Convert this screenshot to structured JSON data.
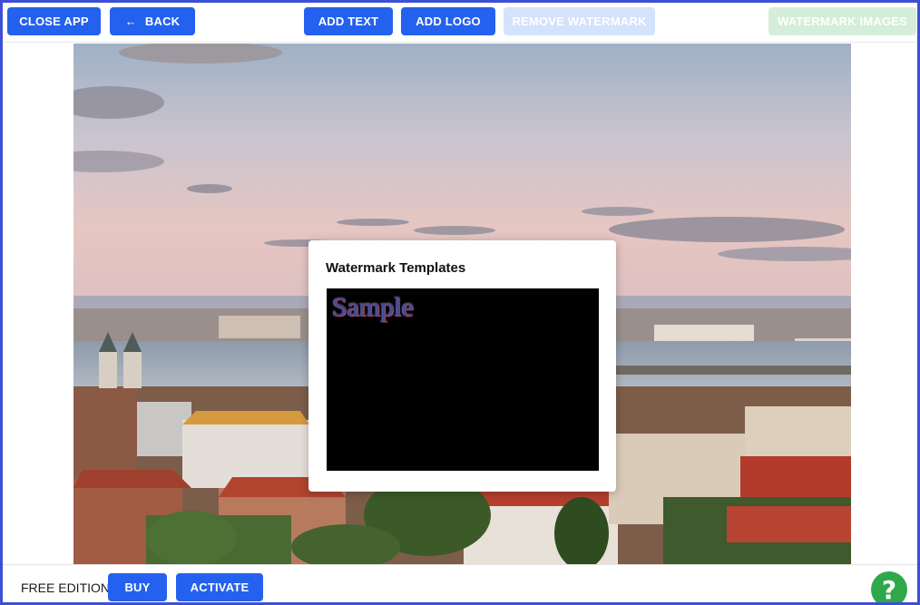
{
  "toolbar": {
    "close_app": "CLOSE APP",
    "back": "BACK",
    "back_icon": "back-arrow-icon",
    "add_text": "ADD TEXT",
    "add_logo": "ADD LOGO",
    "remove_watermark": "REMOVE WATERMARK",
    "watermark_images": "WATERMARK IMAGES"
  },
  "modal": {
    "title": "Watermark Templates",
    "templates": [
      {
        "sample_text": "Sample"
      }
    ]
  },
  "footer": {
    "edition": "FREE EDITION",
    "buy": "BUY",
    "activate": "ACTIVATE",
    "help_icon": "question-icon",
    "help_glyph": "?"
  },
  "colors": {
    "frame": "#3d4fd6",
    "primary_button": "#2461ee",
    "disabled_button": "#d5e2fc",
    "disabled_green_button": "#d4eed9",
    "help_button": "#2fa84a"
  }
}
